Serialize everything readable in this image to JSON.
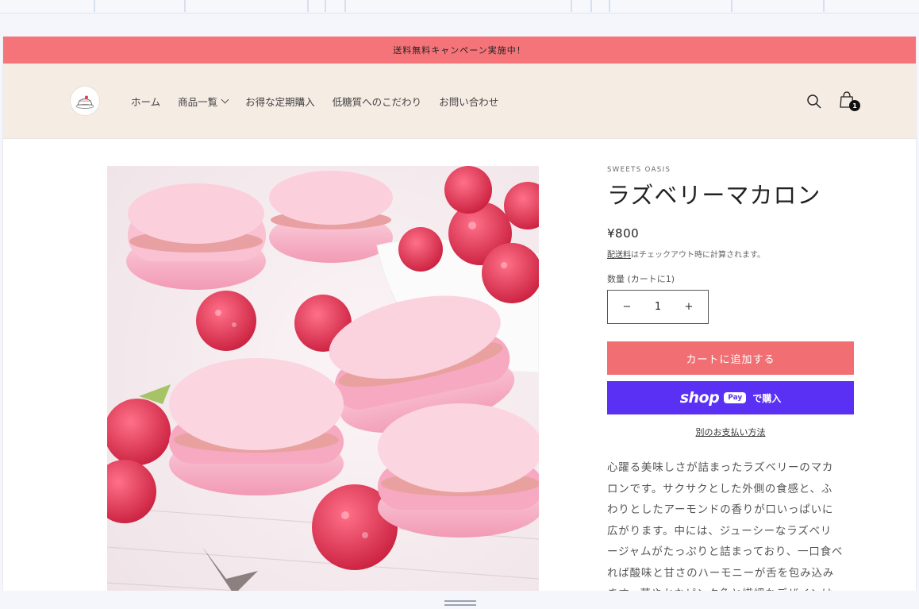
{
  "announcement": {
    "text": "送料無料キャンペーン実施中！"
  },
  "header": {
    "logo_text": "SWEETS OASIS",
    "nav": [
      {
        "label": "ホーム",
        "has_dropdown": false
      },
      {
        "label": "商品一覧",
        "has_dropdown": true
      },
      {
        "label": "お得な定期購入",
        "has_dropdown": false
      },
      {
        "label": "低糖質へのこだわり",
        "has_dropdown": false
      },
      {
        "label": "お問い合わせ",
        "has_dropdown": false
      }
    ],
    "search_icon": "search-icon",
    "cart_icon": "cart-icon",
    "cart_count": "1"
  },
  "product": {
    "vendor": "SWEETS OASIS",
    "title": "ラズベリーマカロン",
    "price": "¥800",
    "shipping_link": "配送料",
    "shipping_rest": "はチェックアウト時に計算されます。",
    "quantity_label": "数量 (カートに1)",
    "quantity_value": "1",
    "minus": "−",
    "plus": "+",
    "add_to_cart": "カートに追加する",
    "shop_pay": {
      "shop": "shop",
      "pay": "Pay",
      "buy": "で購入"
    },
    "more_payment": "別のお支払い方法",
    "description_lines": [
      "心躍る美味しさが詰まったラズベリーのマカ",
      "ロンです。サクサクとした外側の食感と、ふ",
      "わりとしたアーモンドの香りが口いっぱいに",
      "広がります。中には、ジューシーなラズベリ",
      "ージャムがたっぷりと詰まっており、一口食べ",
      "れば酸味と甘さのハーモニーが舌を包み込み",
      "ます。華やかなピンク色と繊細なデザインは"
    ]
  },
  "colors": {
    "announcement_bg": "#f47479",
    "header_bg": "#f5ece4",
    "add_to_cart_bg": "#f16f72",
    "shop_pay_bg": "#5a31f4",
    "macaron_pink": "#f7aec3",
    "raspberry": "#e23a55"
  }
}
